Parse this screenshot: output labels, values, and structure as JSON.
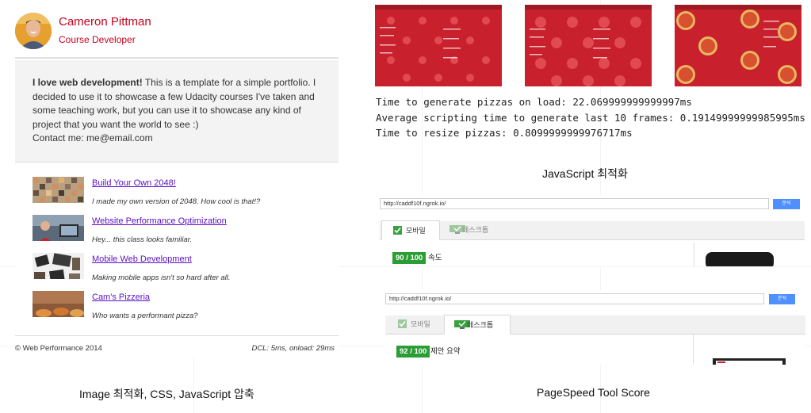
{
  "portfolio": {
    "name": "Cameron Pittman",
    "role": "Course Developer",
    "about_bold": "I love web development!",
    "about_text": " This is a template for a simple portfolio. I decided to use it to showcase a few Udacity courses I've taken and some teaching work, but you can use it to showcase any kind of project that you want the world to see :)",
    "contact": "Contact me: me@email.com",
    "projects": [
      {
        "title": "Build Your Own 2048!",
        "desc": "I made my own version of 2048. How cool is that!?"
      },
      {
        "title": "Website Performance Optimization",
        "desc": "Hey... this class looks familiar."
      },
      {
        "title": "Mobile Web Development",
        "desc": "Making mobile apps isn't so hard after all."
      },
      {
        "title": "Cam's Pizzeria",
        "desc": "Who wants a performant pizza?"
      }
    ],
    "footer_left": "© Web Performance 2014",
    "footer_right": "DCL: 5ms, onload: 29ms"
  },
  "captions": {
    "left": "Image 최적화, CSS, JavaScript 압축",
    "js": "JavaScript 최적화",
    "pagespeed": "PageSpeed Tool Score"
  },
  "console": {
    "line1": "Time to generate pizzas on load: 22.069999999999997ms",
    "line2": "Average scripting time to generate last 10 frames: 0.19149999999985995ms",
    "line3": "Time to resize pizzas: 0.8099999999976717ms"
  },
  "pagespeed_mobile": {
    "url": "http://caddf10f.ngrok.io/",
    "button": "분석",
    "tab_mobile": "모바일",
    "tab_desktop": "데스크톱",
    "score": "90 / 100",
    "score_label": "속도"
  },
  "pagespeed_desktop": {
    "url": "http://caddf10f.ngrok.io/",
    "button": "분석",
    "tab_mobile": "모바일",
    "tab_desktop": "데스크톱",
    "score": "92 / 100",
    "score_label": "제안 요약"
  },
  "colors": {
    "accent_red": "#c8001e",
    "link_purple": "#5a10c8",
    "pizza_bg": "#c8202c",
    "score_green": "#2a9d35",
    "button_blue": "#4d90fe"
  }
}
